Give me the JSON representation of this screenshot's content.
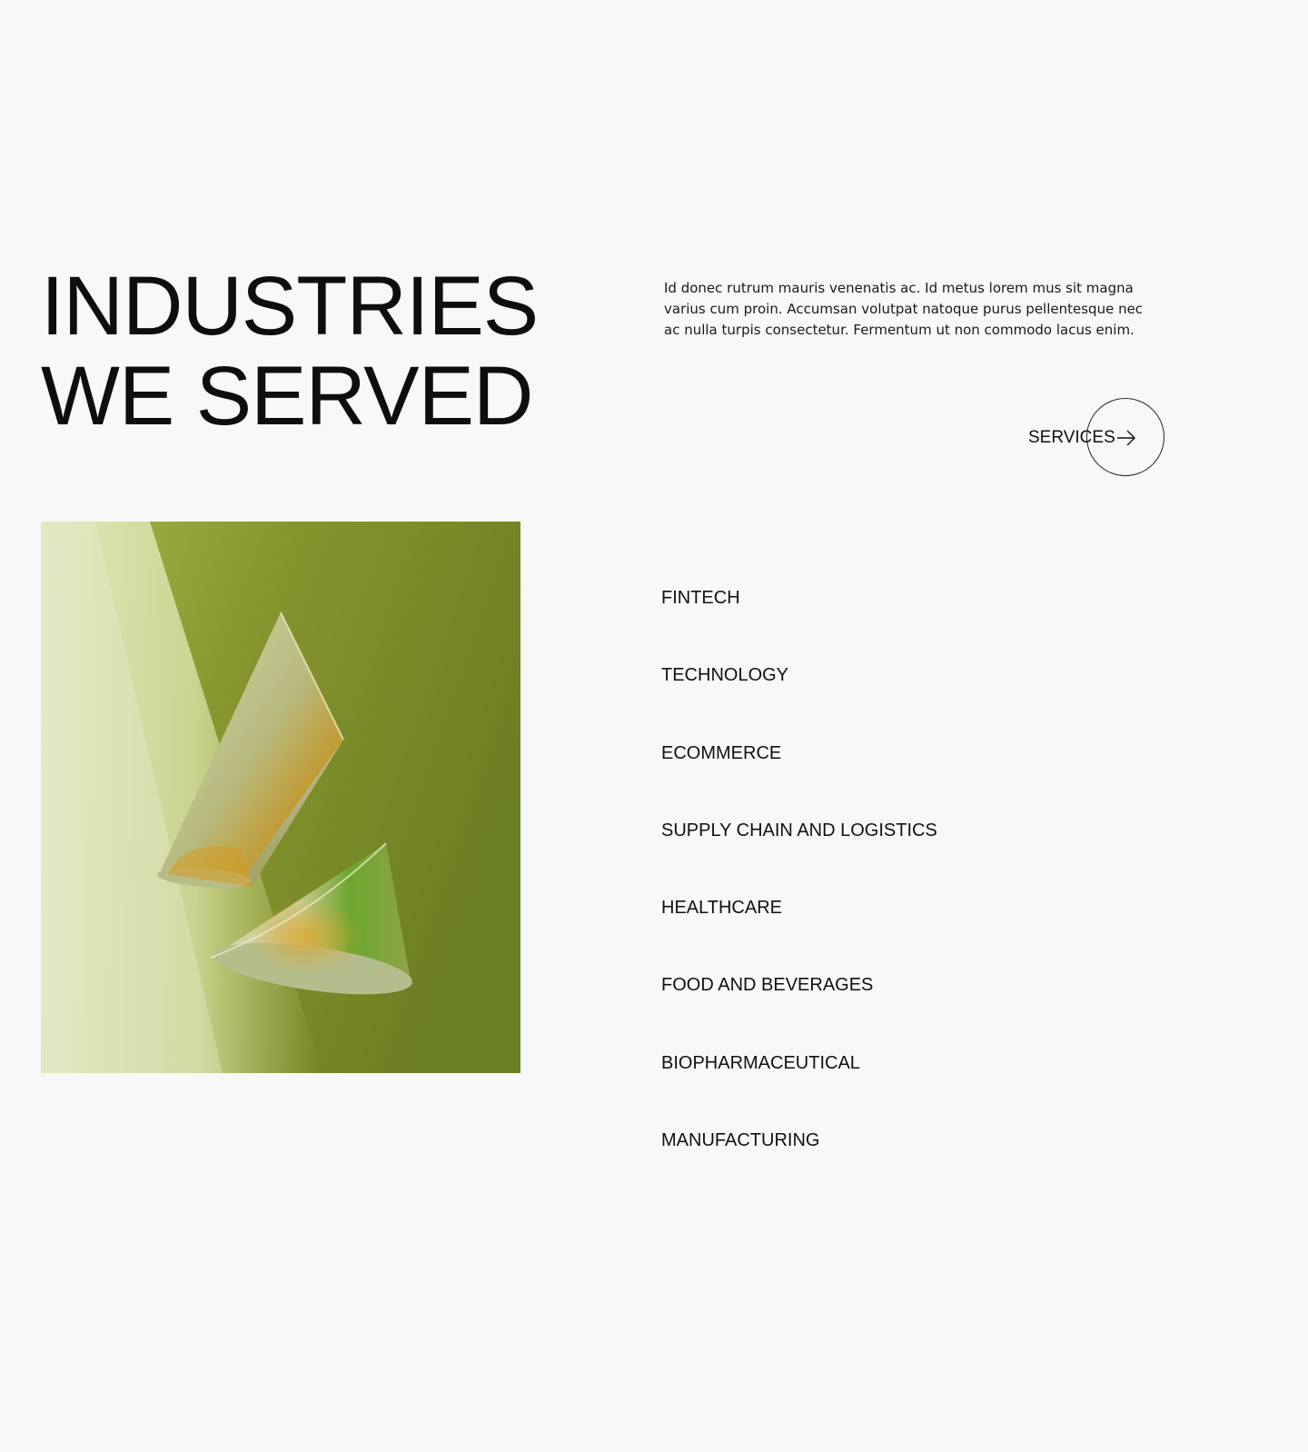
{
  "section": {
    "title_line1": "INDUSTRIES",
    "title_line2": "WE SERVED",
    "intro": "Id donec rutrum mauris venenatis ac. Id metus lorem mus sit magna varius cum proin. Accumsan volutpat natoque purus pellentesque nec ac nulla turpis consectetur. Fermentum ut non commodo lacus enim.",
    "services_button": {
      "label": "SERVICES",
      "icon": "arrow-right-icon"
    },
    "image": {
      "subject": "abstract-3d-glass-cones",
      "colors": [
        "#85962f",
        "#d9e0ab",
        "#c98f19"
      ]
    }
  },
  "industries": [
    "FINTECH",
    "TECHNOLOGY",
    "ECOMMERCE",
    "SUPPLY CHAIN AND LOGISTICS",
    "HEALTHCARE",
    "FOOD AND BEVERAGES",
    "BIOPHARMACEUTICAL",
    "MANUFACTURING"
  ],
  "colors": {
    "background": "#f8f8f8",
    "text": "#111111",
    "accent_green": "#85962f"
  }
}
